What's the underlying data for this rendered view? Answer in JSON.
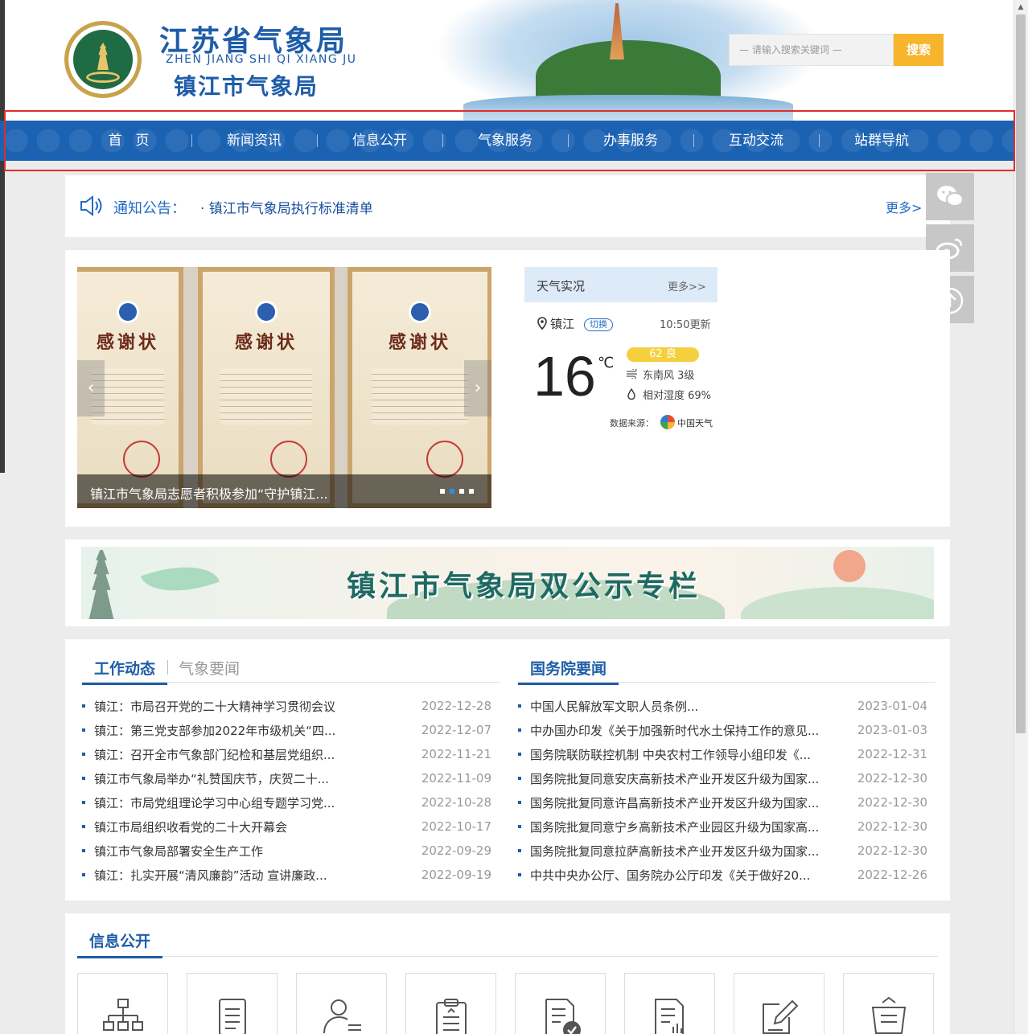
{
  "header": {
    "org_name_provincial": "江苏省气象局",
    "org_name_pinyin": "ZHEN JIANG SHI QI XIANG JU",
    "org_name_city": "镇江市气象局",
    "search": {
      "placeholder": "— 请输入搜索关键词 —",
      "button_label": "搜索"
    }
  },
  "nav": {
    "items": [
      "首　页",
      "新闻资讯",
      "信息公开",
      "气象服务",
      "办事服务",
      "互动交流",
      "站群导航"
    ],
    "color": "#1b62b3"
  },
  "notice": {
    "label": "通知公告：",
    "text": "·  镇江市气象局执行标准清单",
    "more": "更多>"
  },
  "side_buttons": [
    "wechat-icon",
    "weibo-icon",
    "back-to-top-icon"
  ],
  "carousel": {
    "caption": "镇江市气象局志愿者积极参加“守护镇江...",
    "certificate_title": "感谢状",
    "slide_count": 4,
    "active_slide": 2
  },
  "weather": {
    "title": "天气实况",
    "more": "更多>>",
    "city": "镇江",
    "switch_label": "切换",
    "updated": "10:50更新",
    "temperature": "16",
    "unit": "℃",
    "aqi": "62 良",
    "wind": "东南风 3级",
    "humidity": "相对湿度 69%",
    "source_label": "数据来源：",
    "source_name": "中国天气"
  },
  "banner": {
    "title": "镇江市气象局双公示专栏"
  },
  "news_left": {
    "tab_active": "工作动态",
    "tab_inactive": "气象要闻",
    "items": [
      {
        "title": "镇江：市局召开党的二十大精神学习贯彻会议",
        "date": "2022-12-28"
      },
      {
        "title": "镇江：第三党支部参加2022年市级机关“四...",
        "date": "2022-12-07"
      },
      {
        "title": "镇江：召开全市气象部门纪检和基层党组织...",
        "date": "2022-11-21"
      },
      {
        "title": "镇江市气象局举办“礼赞国庆节，庆贺二十...",
        "date": "2022-11-09"
      },
      {
        "title": "镇江：市局党组理论学习中心组专题学习党...",
        "date": "2022-10-28"
      },
      {
        "title": "镇江市局组织收看党的二十大开幕会",
        "date": "2022-10-17"
      },
      {
        "title": "镇江市气象局部署安全生产工作",
        "date": "2022-09-29"
      },
      {
        "title": "镇江：扎实开展“清风廉韵”活动 宣讲廉政...",
        "date": "2022-09-19"
      }
    ]
  },
  "news_right": {
    "tab_active": "国务院要闻",
    "items": [
      {
        "title": "中国人民解放军文职人员条例...",
        "date": "2023-01-04"
      },
      {
        "title": "中办国办印发《关于加强新时代水土保持工作的意见...",
        "date": "2023-01-03"
      },
      {
        "title": "国务院联防联控机制 中央农村工作领导小组印发《...",
        "date": "2022-12-31"
      },
      {
        "title": "国务院批复同意安庆高新技术产业开发区升级为国家...",
        "date": "2022-12-30"
      },
      {
        "title": "国务院批复同意许昌高新技术产业开发区升级为国家...",
        "date": "2022-12-30"
      },
      {
        "title": "国务院批复同意宁乡高新技术产业园区升级为国家高...",
        "date": "2022-12-30"
      },
      {
        "title": "国务院批复同意拉萨高新技术产业开发区升级为国家...",
        "date": "2022-12-30"
      },
      {
        "title": "中共中央办公厅、国务院办公厅印发《关于做好20...",
        "date": "2022-12-26"
      }
    ]
  },
  "info_public": {
    "title": "信息公开",
    "icons": [
      "org-chart-icon",
      "document-icon",
      "user-list-icon",
      "clipboard-chart-icon",
      "document-check-icon",
      "report-chart-icon",
      "edit-form-icon",
      "tray-icon"
    ]
  }
}
